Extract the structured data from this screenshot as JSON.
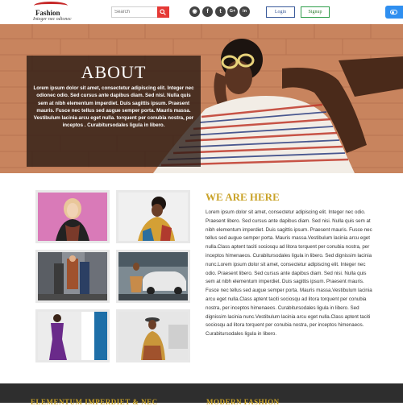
{
  "header": {
    "logo": {
      "name": "Fashion",
      "tagline": "Integer nec odionec"
    },
    "search": {
      "placeholder": "Search"
    },
    "social": [
      {
        "icon": "rss-icon",
        "glyph": "◉"
      },
      {
        "icon": "facebook-icon",
        "glyph": "f"
      },
      {
        "icon": "twitter-icon",
        "glyph": "t"
      },
      {
        "icon": "google-plus-icon",
        "glyph": "G+"
      },
      {
        "icon": "linkedin-icon",
        "glyph": "in"
      }
    ],
    "login_label": "Login",
    "signup_label": "Signup"
  },
  "hero": {
    "title": "ABOUT",
    "text": "Lorem ipsum dolor sit amet, consectetur adipiscing elit. Integer nec odionec odio. Sed cursus ante dapibus diam. Sed nisi. Nulla quis sem at nibh elementum imperdiet. Duis sagittis ipsum. Praesent mauris. Fusce nec tellus sed augue semper porta. Mauris massa. Vestibulum lacinia arcu eget nulla. torquent per conubia nostra, per inceptos . Curabitursodales ligula in libero."
  },
  "main": {
    "title": "WE ARE HERE",
    "text": "Lorem ipsum dolor sit amet, consectetur adipiscing elit. Integer nec odio. Praesent libero. Sed cursus ante dapibus diam. Sed nisi. Nulla quis sem at nibh elementum imperdiet. Duis sagittis ipsum. Praesent mauris. Fusce nec tellus sed augue semper porta. Mauris massa.Vestibulum lacinia arcu eget nulla.Class aptent taciti sociosqu ad litora torquent per conubia nostra, per inceptos himenaeos. Curabitursodales ligula in libero. Sed dignissim lacinia nunc.Lorem ipsum dolor sit amet, consectetur adipiscing elit. Integer nec odio. Praesent libero. Sed cursus ante dapibus diam. Sed nisi. Nulla quis sem at nibh elementum imperdiet. Duis sagittis ipsum. Praesent mauris. Fusce nec tellus sed augue semper porta. Mauris massa.Vestibulum lacinia arcu eget nulla.Class aptent taciti sociosqu ad litora torquent per conubia nostra, per inceptos himenaeos. Curabitursodales ligula in libero. Sed dignissim lacinia nunc.Vestibulum lacinia arcu eget nulla.Class aptent taciti sociosqu ad litora torquent per conubia nostra, per inceptos himenaeos. Curabitursodales ligula in libero."
  },
  "footer": {
    "col1_title": "ELEMENTUM IMPERDIET & NEC",
    "col2_title": "MODERN FASHION"
  },
  "colors": {
    "accent_gold": "#c9a227",
    "header_search_button": "#e53935",
    "toggle_blue": "#2f8ff0",
    "footer_bg": "#2e2e2e"
  }
}
